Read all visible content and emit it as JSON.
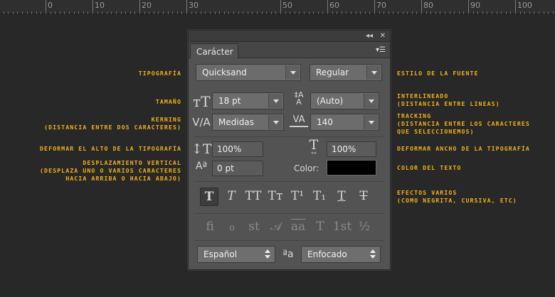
{
  "ruler": {
    "labels": [
      "0",
      "10",
      "20",
      "30",
      "50",
      "60",
      "70",
      "80",
      "90",
      "100"
    ]
  },
  "annotations": {
    "tipografia": "TIPOGRAFÍA",
    "estilo": "ESTILO DE LA FUENTE",
    "tamano": "TAMAÑO",
    "interlineado_1": "INTERLINEADO",
    "interlineado_2": "(DISTANCIA ENTRE LINEAS)",
    "kerning_1": "KERNING",
    "kerning_2": "(DISTANCIA ENTRE DOS CARACTERES)",
    "tracking_1": "TRACKING",
    "tracking_2": "(DISTANCIA ENTRE LOS CARACTERES",
    "tracking_3": "QUE SELECCIONEMOS)",
    "alto": "DEFORMAR EL ALTO DE LA TIPOGRAFÍA",
    "ancho": "DEFORMAR ANCHO DE LA TIPOGRAFÍA",
    "desp_1": "DESPLAZAMIENTO VERTICAL",
    "desp_2": "(DESPLAZA UNO O VARIOS CARACTERES",
    "desp_3": "HACIA ARRIBA O HACIA ABAJO)",
    "color": "COLOR DEL TEXTO",
    "efectos_1": "EFECTOS VARIOS",
    "efectos_2": "(COMO NEGRITA, CURSIVA, ETC)"
  },
  "panel": {
    "collapse_glyph": "◂◂",
    "close_glyph": "✕",
    "tab_label": "Carácter",
    "menu_glyph": "▾☰",
    "font_family": "Quicksand",
    "font_style": "Regular",
    "font_size": "18 pt",
    "leading": "(Auto)",
    "kerning": "Medidas",
    "tracking": "140",
    "vertical_scale": "100%",
    "horizontal_scale": "100%",
    "baseline_shift": "0 pt",
    "color_label": "Color:",
    "color_value": "#000000",
    "language": "Español",
    "antialias": "Enfocado",
    "style_buttons": [
      "T",
      "T",
      "TT",
      "Tт",
      "T¹",
      "T₁",
      "T",
      "T"
    ],
    "opentype_buttons": [
      "fi",
      "ℴ",
      "st",
      "𝒜",
      "aa",
      "T",
      "1st",
      "½"
    ],
    "aa_glyph": "ªa"
  }
}
